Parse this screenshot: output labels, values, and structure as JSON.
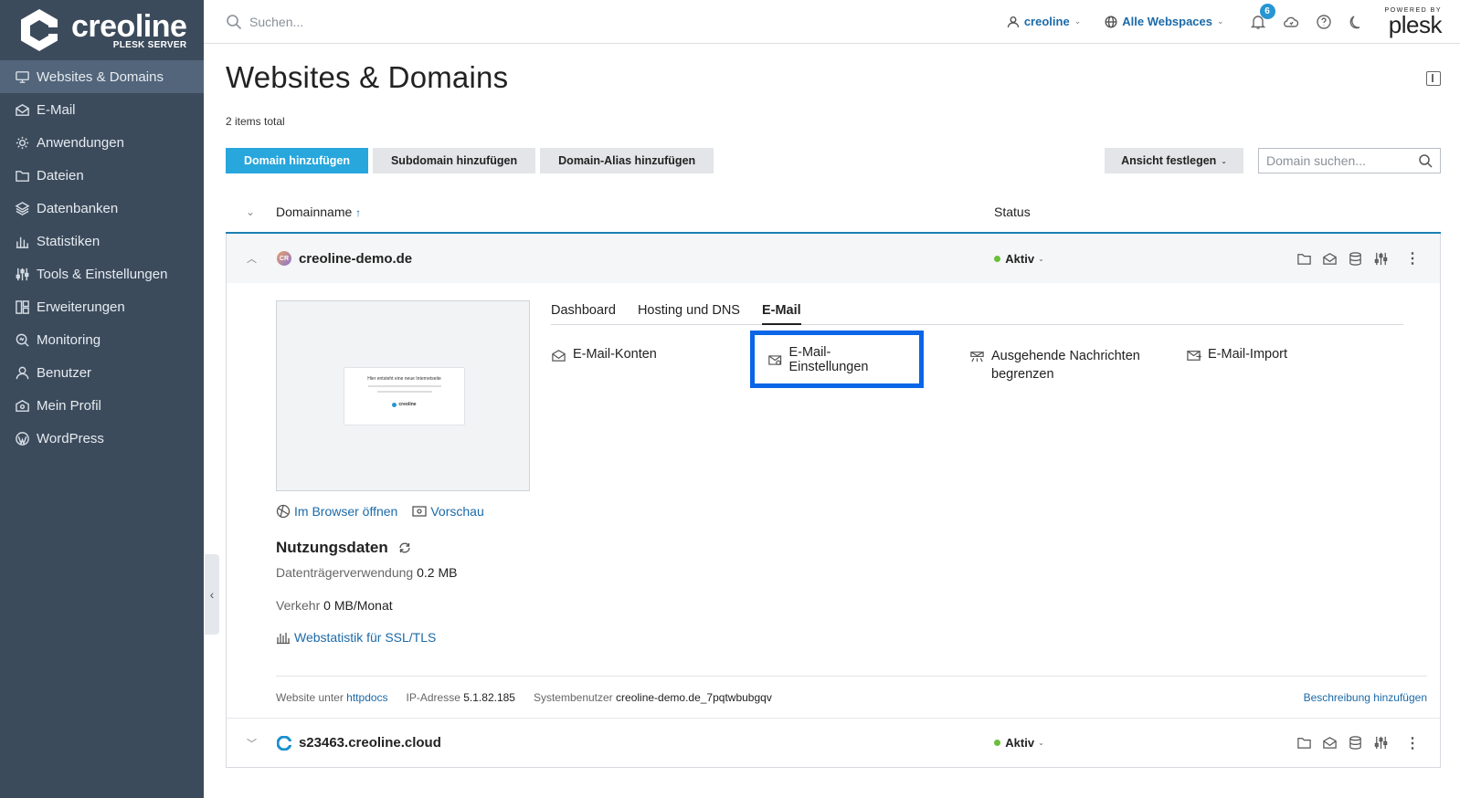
{
  "brand": {
    "name": "creoline",
    "subtitle": "PLESK SERVER",
    "powered_small": "POWERED BY",
    "powered_big": "plesk"
  },
  "sidebar": {
    "items": [
      {
        "label": "Websites & Domains",
        "icon": "monitor-icon",
        "active": true
      },
      {
        "label": "E-Mail",
        "icon": "mail-icon"
      },
      {
        "label": "Anwendungen",
        "icon": "gear-icon"
      },
      {
        "label": "Dateien",
        "icon": "folder-icon"
      },
      {
        "label": "Datenbanken",
        "icon": "layers-icon"
      },
      {
        "label": "Statistiken",
        "icon": "bar-chart-icon"
      },
      {
        "label": "Tools & Einstellungen",
        "icon": "sliders-icon"
      },
      {
        "label": "Erweiterungen",
        "icon": "puzzle-icon"
      },
      {
        "label": "Monitoring",
        "icon": "magnifier-icon"
      },
      {
        "label": "Benutzer",
        "icon": "user-icon"
      },
      {
        "label": "Mein Profil",
        "icon": "profile-icon"
      },
      {
        "label": "WordPress",
        "icon": "wordpress-icon"
      }
    ]
  },
  "topbar": {
    "search_placeholder": "Suchen...",
    "user": "creoline",
    "webspaces": "Alle Webspaces",
    "notification_count": "6"
  },
  "main": {
    "title": "Websites & Domains",
    "items_total": "2 items total",
    "buttons": {
      "add_domain": "Domain hinzufügen",
      "add_subdomain": "Subdomain hinzufügen",
      "add_alias": "Domain-Alias hinzufügen",
      "view": "Ansicht festlegen"
    },
    "domain_search_placeholder": "Domain suchen...",
    "columns": {
      "name": "Domainname",
      "sort_arrow": "↑",
      "status": "Status"
    }
  },
  "domains": [
    {
      "name": "creoline-demo.de",
      "favicon_text": "CR",
      "status": "Aktiv",
      "expanded": true,
      "preview": {
        "title": "Hier entsteht eine neue Internetseite",
        "logo": "creoline"
      },
      "links": {
        "open_browser": "Im Browser öffnen",
        "preview": "Vorschau"
      },
      "usage": {
        "title": "Nutzungsdaten",
        "disk_label": "Datenträgerverwendung",
        "disk_value": "0.2 MB",
        "traffic_label": "Verkehr",
        "traffic_value": "0 MB/Monat",
        "webstat": "Webstatistik für SSL/TLS"
      },
      "tabs": [
        "Dashboard",
        "Hosting und DNS",
        "E-Mail"
      ],
      "active_tab": "E-Mail",
      "tools": {
        "accounts": "E-Mail-Konten",
        "settings": "E-Mail-Einstellungen",
        "outgoing_1": "Ausgehende Nachrichten",
        "outgoing_2": "begrenzen",
        "import": "E-Mail-Import"
      },
      "footer": {
        "website_label": "Website unter",
        "website_value": "httpdocs",
        "ip_label": "IP-Adresse",
        "ip_value": "5.1.82.185",
        "sysuser_label": "Systembenutzer",
        "sysuser_value": "creoline-demo.de_7pqtwbubgqv",
        "add_description": "Beschreibung hinzufügen"
      }
    },
    {
      "name": "s23463.creoline.cloud",
      "status": "Aktiv",
      "expanded": false
    }
  ],
  "colors": {
    "sidebar_bg": "#3c4b5c",
    "primary": "#28a7dd",
    "link": "#1b6aa8",
    "status_active": "#6abf3c",
    "highlight": "#0a66e6"
  }
}
